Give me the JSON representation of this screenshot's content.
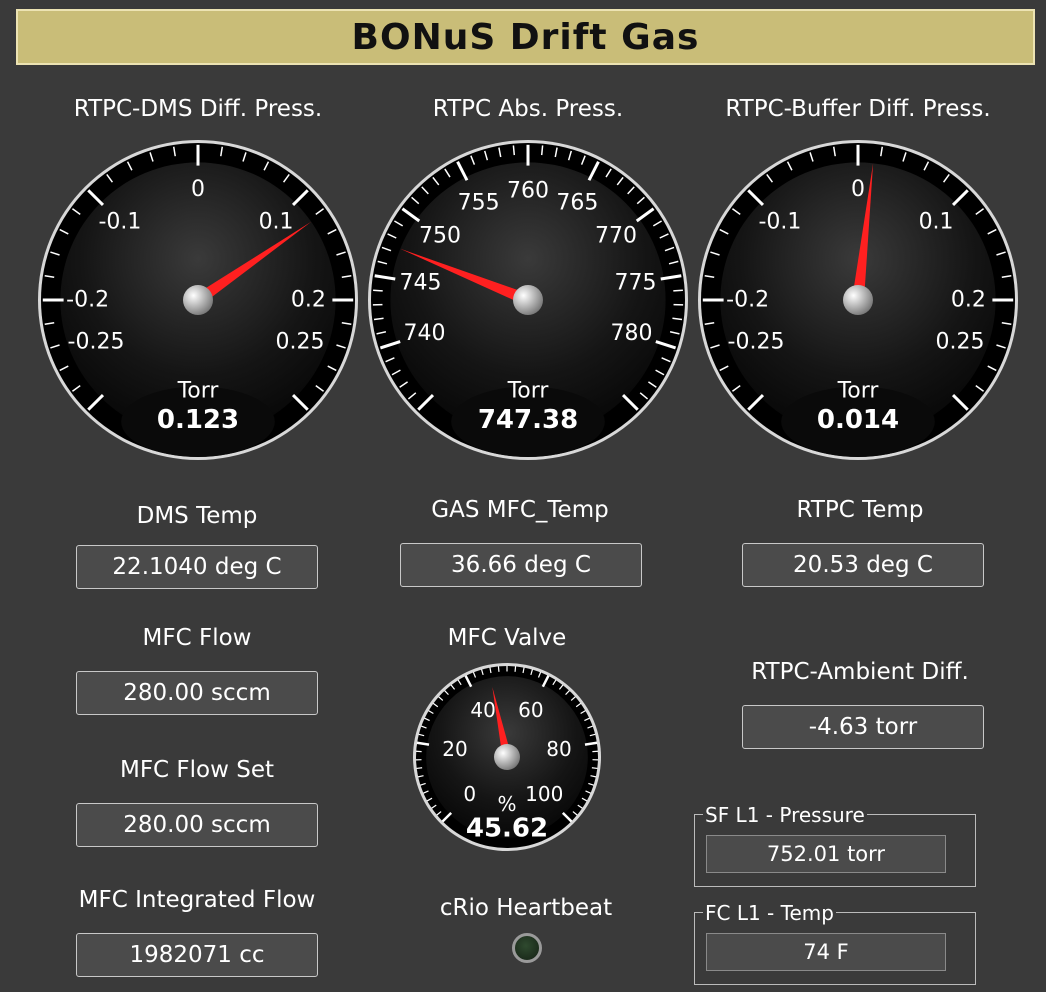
{
  "title": "BONuS Drift Gas",
  "colors": {
    "title_bg": "#c9bd78",
    "needle": "#ff2020",
    "background": "#3a3a3a",
    "led_off": "#1e321e"
  },
  "gauges": [
    {
      "id": "dms",
      "label": "RTPC-DMS Diff. Press.",
      "unit": "Torr",
      "value": 0.123,
      "value_text": "0.123",
      "min": -0.3,
      "max": 0.3,
      "sweep_deg": 270,
      "tick_labels": [
        {
          "v": -0.25,
          "t": "-0.25"
        },
        {
          "v": -0.2,
          "t": "-0.2"
        },
        {
          "v": -0.1,
          "t": "-0.1"
        },
        {
          "v": 0,
          "t": "0"
        },
        {
          "v": 0.1,
          "t": "0.1"
        },
        {
          "v": 0.2,
          "t": "0.2"
        },
        {
          "v": 0.25,
          "t": "0.25"
        }
      ]
    },
    {
      "id": "abs",
      "label": "RTPC Abs. Press.",
      "unit": "Torr",
      "value": 747.38,
      "value_text": "747.38",
      "min": 735,
      "max": 785,
      "sweep_deg": 270,
      "tick_labels": [
        {
          "v": 740,
          "t": "740"
        },
        {
          "v": 745,
          "t": "745"
        },
        {
          "v": 750,
          "t": "750"
        },
        {
          "v": 755,
          "t": "755"
        },
        {
          "v": 760,
          "t": "760"
        },
        {
          "v": 765,
          "t": "765"
        },
        {
          "v": 770,
          "t": "770"
        },
        {
          "v": 775,
          "t": "775"
        },
        {
          "v": 780,
          "t": "780"
        }
      ]
    },
    {
      "id": "buf",
      "label": "RTPC-Buffer Diff. Press.",
      "unit": "Torr",
      "value": 0.014,
      "value_text": "0.014",
      "min": -0.3,
      "max": 0.3,
      "sweep_deg": 270,
      "tick_labels": [
        {
          "v": -0.25,
          "t": "-0.25"
        },
        {
          "v": -0.2,
          "t": "-0.2"
        },
        {
          "v": -0.1,
          "t": "-0.1"
        },
        {
          "v": 0,
          "t": "0"
        },
        {
          "v": 0.1,
          "t": "0.1"
        },
        {
          "v": 0.2,
          "t": "0.2"
        },
        {
          "v": 0.25,
          "t": "0.25"
        }
      ]
    },
    {
      "id": "valve",
      "label": "MFC Valve",
      "unit": "%",
      "value": 45.62,
      "value_text": "45.62",
      "min": 0,
      "max": 100,
      "sweep_deg": 270,
      "tick_labels": [
        {
          "v": 0,
          "t": "0"
        },
        {
          "v": 20,
          "t": "20"
        },
        {
          "v": 40,
          "t": "40"
        },
        {
          "v": 60,
          "t": "60"
        },
        {
          "v": 80,
          "t": "80"
        },
        {
          "v": 100,
          "t": "100"
        }
      ]
    }
  ],
  "fields": {
    "dms_temp": {
      "label": "DMS Temp",
      "value": "22.1040 deg C"
    },
    "mfc_temp": {
      "label": "GAS MFC_Temp",
      "value": "36.66 deg C"
    },
    "rtpc_temp": {
      "label": "RTPC Temp",
      "value": "20.53 deg C"
    },
    "mfc_flow": {
      "label": "MFC Flow",
      "value": "280.00 sccm"
    },
    "mfc_flow_set": {
      "label": "MFC Flow Set",
      "value": "280.00 sccm"
    },
    "mfc_integrated": {
      "label": "MFC Integrated Flow",
      "value": "1982071 cc"
    },
    "ambient_diff": {
      "label": "RTPC-Ambient Diff.",
      "value": "-4.63 torr"
    }
  },
  "groups": {
    "sf_l1": {
      "label": "SF L1 - Pressure",
      "value": "752.01 torr"
    },
    "fc_l1": {
      "label": "FC L1 - Temp",
      "value": "74 F"
    }
  },
  "heartbeat": {
    "label": "cRio Heartbeat"
  }
}
